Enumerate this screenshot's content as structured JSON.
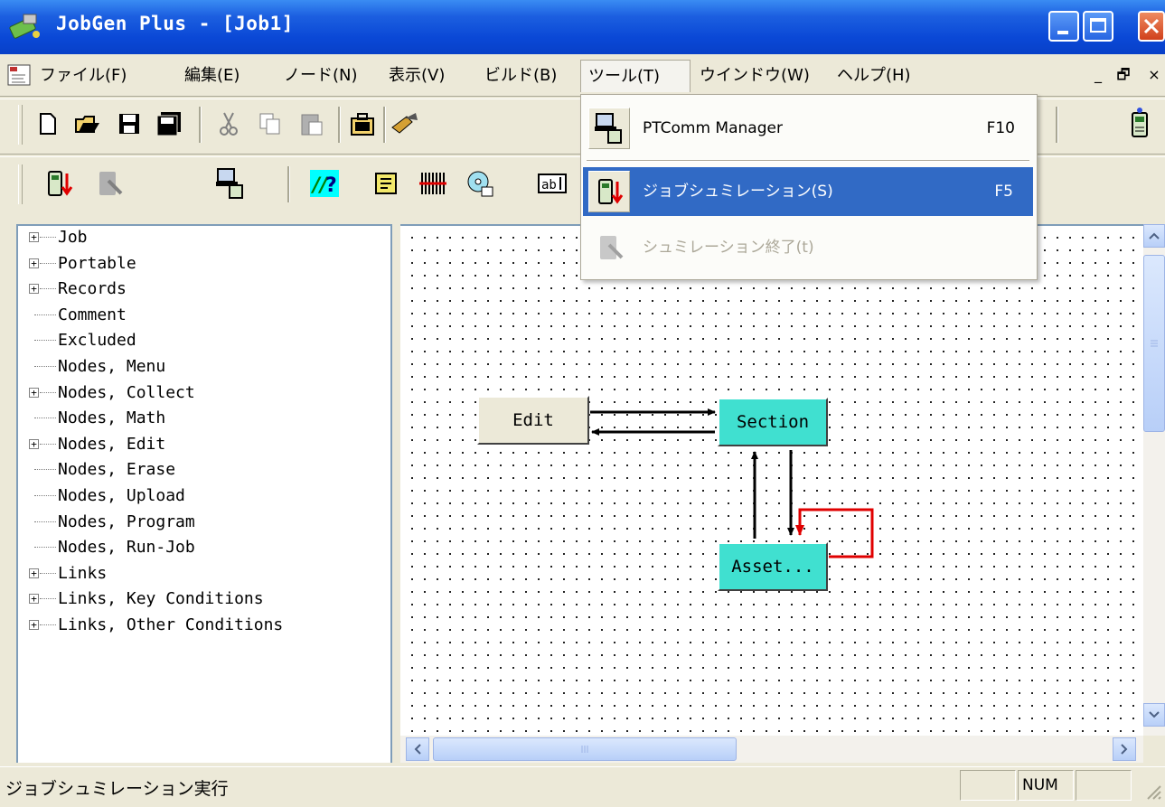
{
  "window": {
    "title": "JobGen Plus - [Job1]"
  },
  "menubar": {
    "items": [
      {
        "label": "ファイル(F)"
      },
      {
        "label": "編集(E)"
      },
      {
        "label": "ノード(N)"
      },
      {
        "label": "表示(V)"
      },
      {
        "label": "ビルド(B)"
      },
      {
        "label": "ツール(T)"
      },
      {
        "label": "ウインドウ(W)"
      },
      {
        "label": "ヘルプ(H)"
      }
    ],
    "mdi_min": "_",
    "mdi_restore": "🗗",
    "mdi_close": "×"
  },
  "tools_menu": {
    "items": [
      {
        "label": "PTComm Manager",
        "shortcut": "F10",
        "state": "normal"
      },
      {
        "label": "ジョブシュミレーション(S)",
        "shortcut": "F5",
        "state": "highlighted"
      },
      {
        "label": "シュミレーション終了(t)",
        "shortcut": "",
        "state": "disabled"
      }
    ]
  },
  "toolbar": {
    "icons": [
      "new-icon",
      "open-icon",
      "save-icon",
      "save-all-icon",
      "cut-icon",
      "copy-icon",
      "paste-icon",
      "project-icon",
      "build-icon",
      "device-icon"
    ],
    "row2_icons": [
      "simulate-icon",
      "end-simulate-icon",
      "ptcomm-icon",
      "prompt-node-icon",
      "text-node-icon",
      "barcode-node-icon",
      "disk-node-icon",
      "field-node-icon",
      "simulate-icon"
    ]
  },
  "tree": {
    "items": [
      {
        "label": "Job",
        "expandable": true
      },
      {
        "label": "Portable",
        "expandable": true
      },
      {
        "label": "Records",
        "expandable": true
      },
      {
        "label": "Comment",
        "expandable": false
      },
      {
        "label": "Excluded",
        "expandable": false
      },
      {
        "label": "Nodes, Menu",
        "expandable": false
      },
      {
        "label": "Nodes, Collect",
        "expandable": true
      },
      {
        "label": "Nodes, Math",
        "expandable": false
      },
      {
        "label": "Nodes, Edit",
        "expandable": true
      },
      {
        "label": "Nodes, Erase",
        "expandable": false
      },
      {
        "label": "Nodes, Upload",
        "expandable": false
      },
      {
        "label": "Nodes, Program",
        "expandable": false
      },
      {
        "label": "Nodes, Run-Job",
        "expandable": false
      },
      {
        "label": "Links",
        "expandable": true
      },
      {
        "label": "Links, Key Conditions",
        "expandable": true
      },
      {
        "label": "Links, Other Conditions",
        "expandable": true
      }
    ]
  },
  "diagram": {
    "nodes": [
      {
        "id": "edit",
        "label": "Edit",
        "color": "#ece9d8"
      },
      {
        "id": "section",
        "label": "Section",
        "color": "#40e0d0"
      },
      {
        "id": "asset",
        "label": "Asset...",
        "color": "#40e0d0"
      }
    ],
    "link_color": "#000000",
    "self_link_color": "#ff0000"
  },
  "statusbar": {
    "text": "ジョブシュミレーション実行",
    "pane_num": "NUM"
  },
  "colors": {
    "accent": "#316ac5",
    "titlebar": "#0a48d6"
  }
}
